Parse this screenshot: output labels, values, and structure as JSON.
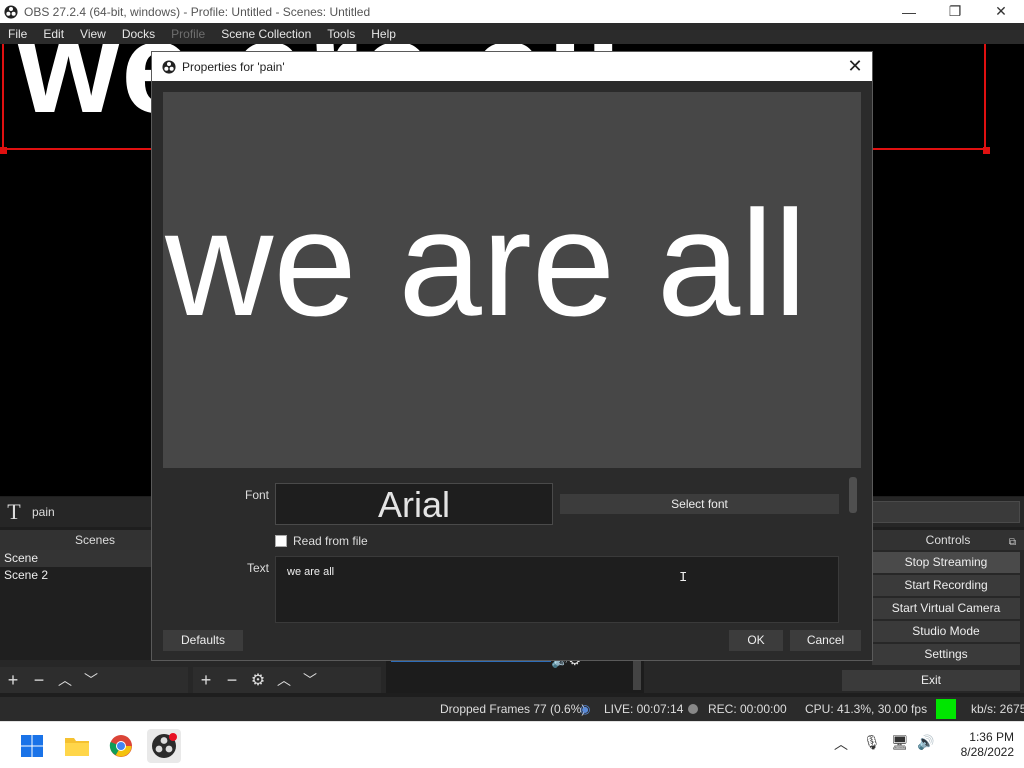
{
  "window": {
    "title": "OBS 27.2.4 (64-bit, windows) - Profile: Untitled - Scenes: Untitled",
    "minimize": "—",
    "restore": "❐",
    "close": "✕"
  },
  "menu": [
    "File",
    "Edit",
    "View",
    "Docks",
    "Profile",
    "Scene Collection",
    "Tools",
    "Help"
  ],
  "preview": {
    "text": "we are all"
  },
  "source": {
    "icon": "T",
    "name": "pain"
  },
  "scenes": {
    "header": "Scenes",
    "items": [
      "Scene",
      "Scene 2"
    ]
  },
  "controls": {
    "header": "Controls",
    "float_icon": "⧉",
    "buttons": [
      "Stop Streaming",
      "Start Recording",
      "Start Virtual Camera",
      "Studio Mode",
      "Settings"
    ],
    "exit": "Exit"
  },
  "status": {
    "dropped": "Dropped Frames 77 (0.6%)",
    "live": "LIVE: 00:07:14",
    "rec": "REC: 00:00:00",
    "cpu": "CPU: 41.3%, 30.00 fps",
    "kbs": "kb/s: 2675",
    "accent_green": "#00e600"
  },
  "dialog": {
    "title": "Properties for 'pain'",
    "close": "✕",
    "preview_text": "we are all",
    "font_label": "Font",
    "font_value": "Arial",
    "select_font": "Select font",
    "read_from_file": "Read from file",
    "read_from_file_checked": false,
    "text_label": "Text",
    "text_value": "we are all",
    "defaults": "Defaults",
    "ok": "OK",
    "cancel": "Cancel"
  },
  "taskbar": {
    "apps": [
      "windows-start",
      "file-explorer",
      "chrome",
      "obs-studio"
    ],
    "time": "1:36 PM",
    "date": "8/28/2022"
  }
}
